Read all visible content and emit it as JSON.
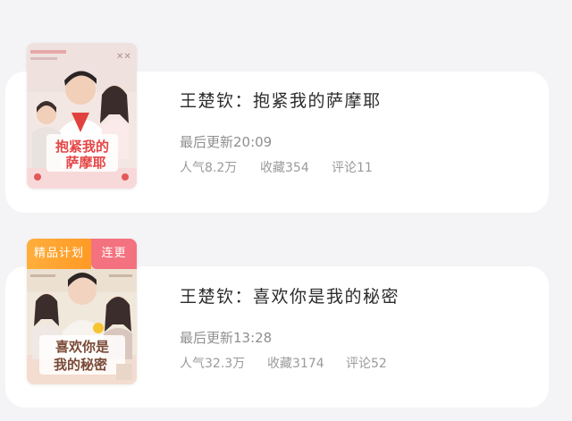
{
  "books": [
    {
      "title": "王楚钦：抱紧我的萨摩耶",
      "updated": "最后更新20:09",
      "popularity": "人气8.2万",
      "favorites": "收藏354",
      "comments": "评论11",
      "cover_title_line1": "抱紧我的",
      "cover_title_line2": "萨摩耶",
      "badges": []
    },
    {
      "title": "王楚钦：喜欢你是我的秘密",
      "updated": "最后更新13:28",
      "popularity": "人气32.3万",
      "favorites": "收藏3174",
      "comments": "评论52",
      "cover_title_line1": "喜欢你是",
      "cover_title_line2": "我的秘密",
      "badges": [
        "精品计划",
        "连更"
      ]
    }
  ],
  "colors": {
    "badge_plan": "#ff9a26",
    "badge_serial": "#f4727f",
    "card_bg": "#ffffff",
    "page_bg": "#f4f3f6"
  }
}
